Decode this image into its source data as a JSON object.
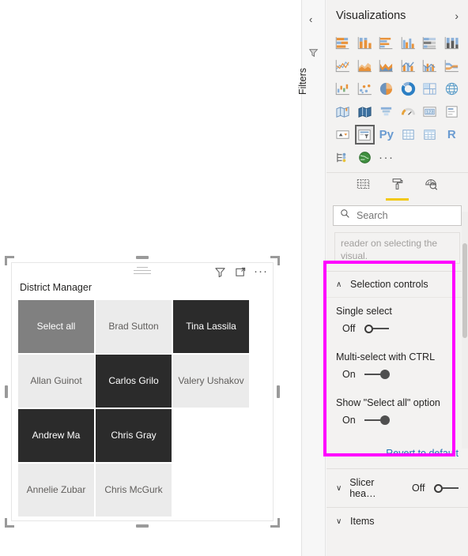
{
  "canvas": {
    "slicer": {
      "title": "District Manager",
      "header_icons": [
        {
          "name": "filter-icon",
          "label": "Filter"
        },
        {
          "name": "focus-mode-icon",
          "label": "Focus mode"
        },
        {
          "name": "more-options-icon",
          "label": "···"
        }
      ],
      "tiles": [
        {
          "label": "Select all",
          "state": "select-all",
          "col": 0,
          "row": 0
        },
        {
          "label": "Brad Sutton",
          "state": "unselected",
          "col": 1,
          "row": 0
        },
        {
          "label": "Tina Lassila",
          "state": "selected",
          "col": 2,
          "row": 0
        },
        {
          "label": "Allan Guinot",
          "state": "unselected",
          "col": 0,
          "row": 1
        },
        {
          "label": "Carlos Grilo",
          "state": "selected",
          "col": 1,
          "row": 1
        },
        {
          "label": "Valery Ushakov",
          "state": "unselected",
          "col": 2,
          "row": 1
        },
        {
          "label": "Andrew Ma",
          "state": "selected",
          "col": 0,
          "row": 2
        },
        {
          "label": "Chris Gray",
          "state": "selected",
          "col": 1,
          "row": 2
        },
        {
          "label": "Annelie Zubar",
          "state": "unselected",
          "col": 0,
          "row": 3
        },
        {
          "label": "Chris McGurk",
          "state": "unselected",
          "col": 1,
          "row": 3
        }
      ]
    }
  },
  "filters_rail": {
    "collapse_chevron": "‹",
    "filter_icon": "filter-icon",
    "label": "Filters"
  },
  "visualizations": {
    "title": "Visualizations",
    "expand_chevron": "›",
    "icons": [
      {
        "name": "stacked-bar-chart-icon"
      },
      {
        "name": "stacked-column-chart-icon"
      },
      {
        "name": "clustered-bar-chart-icon"
      },
      {
        "name": "clustered-column-chart-icon"
      },
      {
        "name": "hundred-percent-stacked-bar-chart-icon"
      },
      {
        "name": "hundred-percent-stacked-column-chart-icon"
      },
      {
        "name": "line-chart-icon"
      },
      {
        "name": "area-chart-icon"
      },
      {
        "name": "stacked-area-chart-icon"
      },
      {
        "name": "line-and-stacked-column-chart-icon"
      },
      {
        "name": "line-and-clustered-column-chart-icon"
      },
      {
        "name": "ribbon-chart-icon"
      },
      {
        "name": "waterfall-chart-icon"
      },
      {
        "name": "scatter-chart-icon"
      },
      {
        "name": "pie-chart-icon"
      },
      {
        "name": "donut-chart-icon"
      },
      {
        "name": "treemap-icon"
      },
      {
        "name": "map-icon"
      },
      {
        "name": "filled-map-icon"
      },
      {
        "name": "shape-map-icon"
      },
      {
        "name": "funnel-chart-icon"
      },
      {
        "name": "gauge-chart-icon"
      },
      {
        "name": "card-icon"
      },
      {
        "name": "multi-row-card-icon"
      },
      {
        "name": "kpi-icon"
      },
      {
        "name": "slicer-icon"
      },
      {
        "name": "python-visual-icon",
        "glyph": "Py"
      },
      {
        "name": "table-icon"
      },
      {
        "name": "matrix-icon"
      },
      {
        "name": "r-script-visual-icon",
        "glyph": "R"
      },
      {
        "name": "decomposition-tree-icon"
      },
      {
        "name": "arcgis-maps-icon"
      },
      {
        "name": "more-visuals-icon",
        "glyph": "···"
      }
    ],
    "active_icon_index": 25,
    "tabs": [
      {
        "name": "fields-tab",
        "label": "Fields",
        "active": false
      },
      {
        "name": "format-tab",
        "label": "Format",
        "active": true
      },
      {
        "name": "analytics-tab",
        "label": "Analytics",
        "active": false
      }
    ],
    "search": {
      "placeholder": "Search",
      "value": "",
      "icon": "search-icon"
    },
    "tooltip_stub_text": "reader on selecting the visual.",
    "selection_controls": {
      "chevron": "∧",
      "title": "Selection controls",
      "properties": [
        {
          "label": "Single select",
          "state": "Off",
          "on": false
        },
        {
          "label": "Multi-select with CTRL",
          "state": "On",
          "on": true
        },
        {
          "label": "Show \"Select all\" option",
          "state": "On",
          "on": true
        }
      ]
    },
    "revert_label": "Revert to default",
    "collapsed_sections": [
      {
        "chevron": "∨",
        "label": "Slicer hea…",
        "state": "Off",
        "on": false,
        "has_toggle": true
      },
      {
        "chevron": "∨",
        "label": "Items",
        "state": "",
        "on": false,
        "has_toggle": false
      }
    ],
    "highlight_color": "#ff00ff"
  }
}
